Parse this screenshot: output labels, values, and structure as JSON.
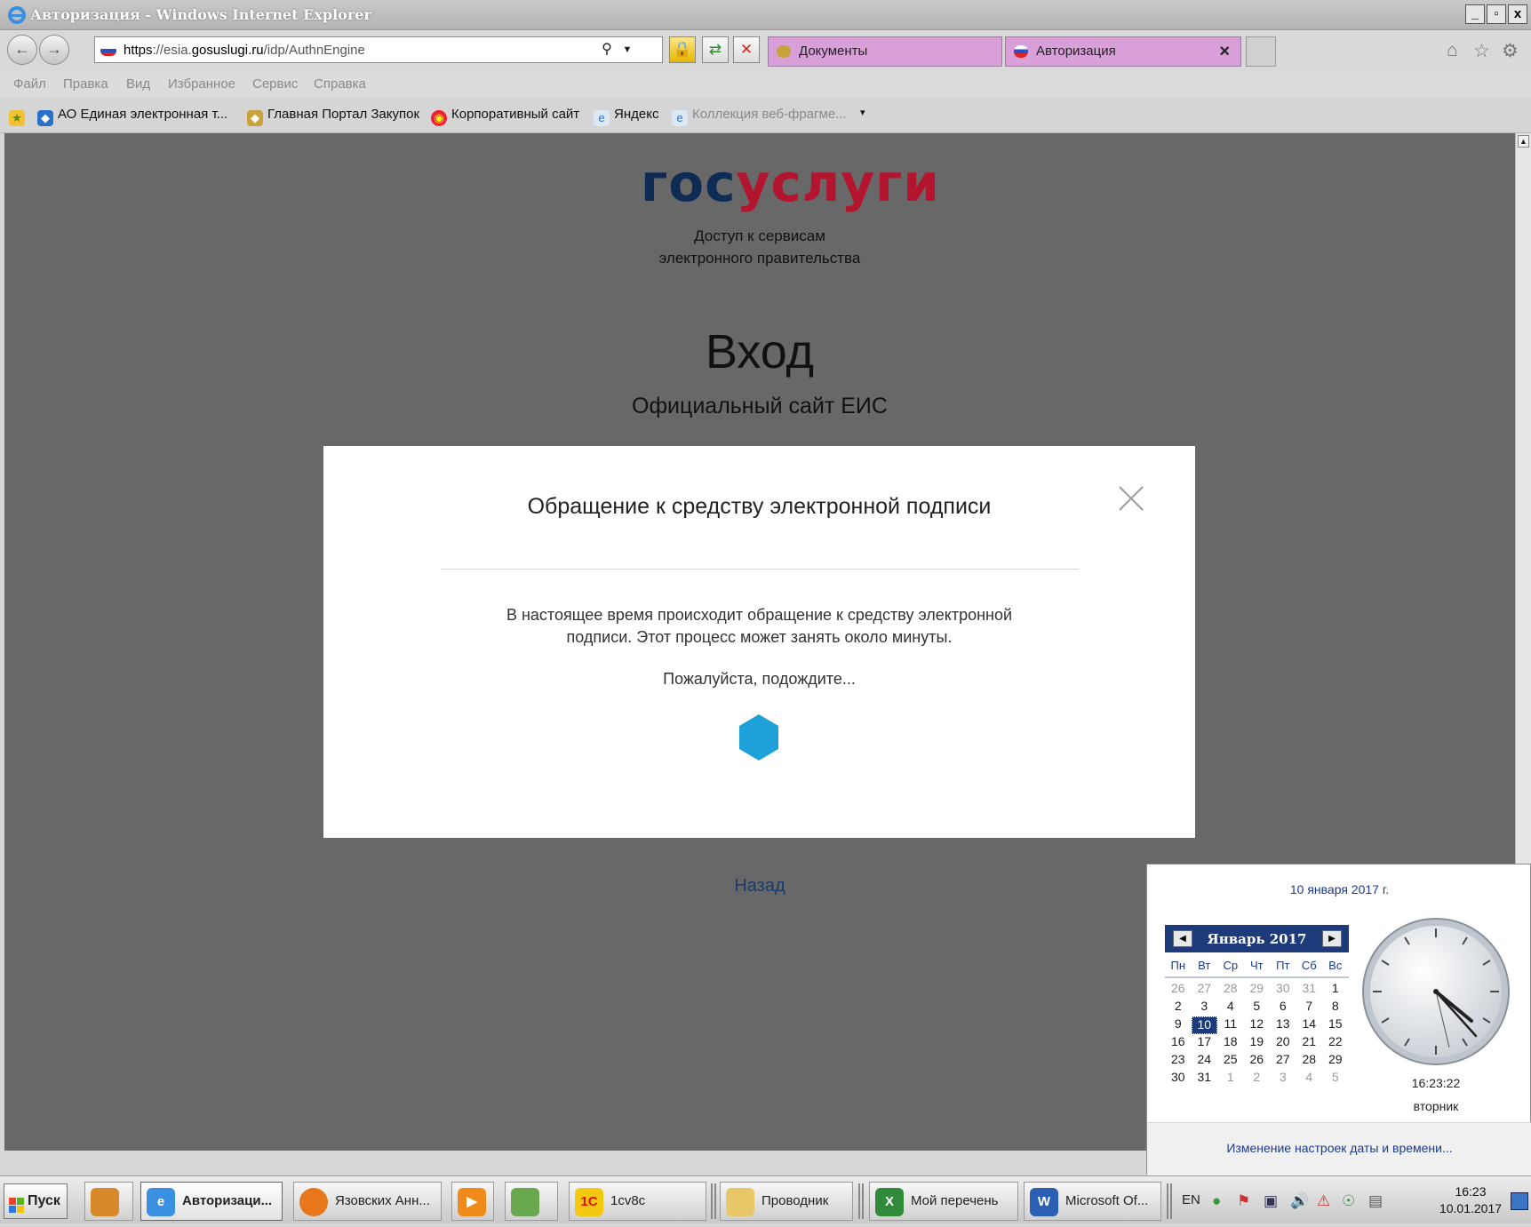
{
  "window": {
    "title": "Авторизация - Windows Internet Explorer",
    "controls": [
      "_",
      "▫",
      "x"
    ]
  },
  "address": {
    "scheme": "https",
    "host_pre": "://esia.",
    "host_main": "gosuslugi.ru",
    "path": "/idp/AuthnEngine"
  },
  "tabs": [
    {
      "label": "Документы"
    },
    {
      "label": "Авторизация",
      "close": "×"
    }
  ],
  "menu": [
    "Файл",
    "Правка",
    "Вид",
    "Избранное",
    "Сервис",
    "Справка"
  ],
  "favorites": [
    "АО Единая электронная т...",
    "Главная Портал Закупок",
    "Корпоративный сайт",
    "Яндекс",
    "Коллекция веб-фрагме...",
    "▾"
  ],
  "page": {
    "logo_a": "гос",
    "logo_b": "услуги",
    "subtitle_1": "Доступ к сервисам",
    "subtitle_2": "электронного правительства",
    "heading": "Вход",
    "site": "Официальный сайт ЕИС",
    "back": "Назад"
  },
  "modal": {
    "title": "Обращение к средству электронной подписи",
    "msg_1": "В настоящее время происходит обращение к средству электронной",
    "msg_2": "подписи. Этот процесс может занять около минуты.",
    "wait": "Пожалуйста, подождите...",
    "spinner_color": "#1ea0d8"
  },
  "calendar": {
    "date_full": "10 января 2017 г.",
    "month": "Январь 2017",
    "weekdays": [
      "Пн",
      "Вт",
      "Ср",
      "Чт",
      "Пт",
      "Сб",
      "Вс"
    ],
    "weeks": [
      [
        "26",
        "27",
        "28",
        "29",
        "30",
        "31",
        "1"
      ],
      [
        "2",
        "3",
        "4",
        "5",
        "6",
        "7",
        "8"
      ],
      [
        "9",
        "10",
        "11",
        "12",
        "13",
        "14",
        "15"
      ],
      [
        "16",
        "17",
        "18",
        "19",
        "20",
        "21",
        "22"
      ],
      [
        "23",
        "24",
        "25",
        "26",
        "27",
        "28",
        "29"
      ],
      [
        "30",
        "31",
        "1",
        "2",
        "3",
        "4",
        "5"
      ]
    ],
    "selected_day": "10",
    "time": "16:23:22",
    "weekday": "вторник",
    "settings_link": "Изменение настроек даты и времени..."
  },
  "taskbar": {
    "start": "Пуск",
    "items": [
      "Авторизаци...",
      "Язовских Анн...",
      "1cv8c",
      "Проводник",
      "Мой перечень",
      "Microsoft Of..."
    ],
    "lang": "EN",
    "clock_time": "16:23",
    "clock_date": "10.01.2017"
  },
  "colors": {
    "brand_dark": "#0e2b54",
    "brand_red": "#b4152e",
    "overlay": "#676867",
    "calendar_header": "#1d3b7a"
  }
}
